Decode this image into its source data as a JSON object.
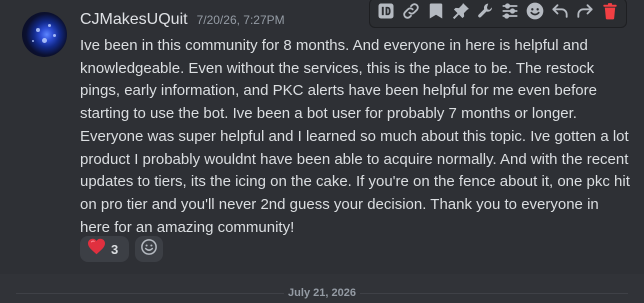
{
  "message": {
    "username": "CJMakesUQuit",
    "timestamp": "7/20/26, 7:27PM",
    "body": "Ive been in this community for 8 months. And everyone in here is helpful and knowledgeable. Even without the services, this is the place to be. The restock pings, early information, and PKC alerts have been helpful for me even before starting to use the bot. Ive been a bot user for probably 7 months or longer. Everyone was super helpful and I learned so much about this topic. Ive gotten a lot product I probably wouldnt have been able to acquire normally. And with the recent updates to tiers, its the icing on the cake. If you're on the fence about it, one pkc hit on pro tier and you'll never 2nd guess your decision. Thank you to everyone in here for an amazing community!",
    "reactions": [
      {
        "icon": "heart-icon",
        "count": "3",
        "color": "#e0303f"
      }
    ]
  },
  "toolbar": {
    "buttons": [
      "copy-id-icon",
      "copy-link-icon",
      "save-icon",
      "pin-icon",
      "tools-icon",
      "apps-icon",
      "add-reaction-icon",
      "reply-icon",
      "forward-icon",
      "delete-icon"
    ],
    "delete_color": "#f23f43"
  },
  "divider": {
    "date": "July 21, 2026"
  }
}
